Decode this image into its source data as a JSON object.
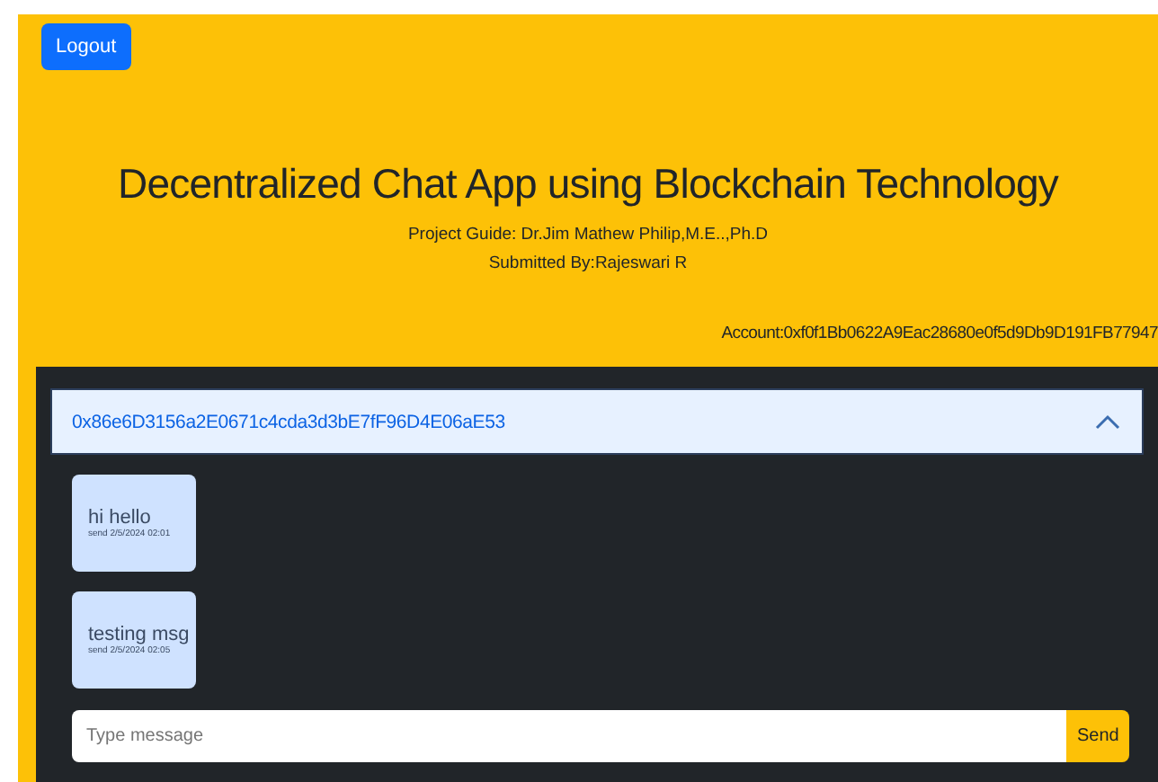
{
  "logout_button": "Logout",
  "header": {
    "title": "Decentralized Chat App using Blockchain Technology",
    "guide": "Project Guide: Dr.Jim Mathew Philip,M.E..,Ph.D",
    "submitted_by": "Submitted By:Rajeswari R",
    "account": "Account:0xf0f1Bb0622A9Eac28680e0f5d9Db9D191FB77947"
  },
  "conversation": {
    "address": "0x86e6D3156a2E0671c4cda3d3bE7fF96D4E06aE53",
    "expanded": true,
    "messages": [
      {
        "text": "hi hello",
        "meta": "send 2/5/2024 02:01"
      },
      {
        "text": "testing msg",
        "meta": "send 2/5/2024 02:05"
      }
    ],
    "composer": {
      "placeholder": "Type message",
      "send": "Send"
    }
  }
}
